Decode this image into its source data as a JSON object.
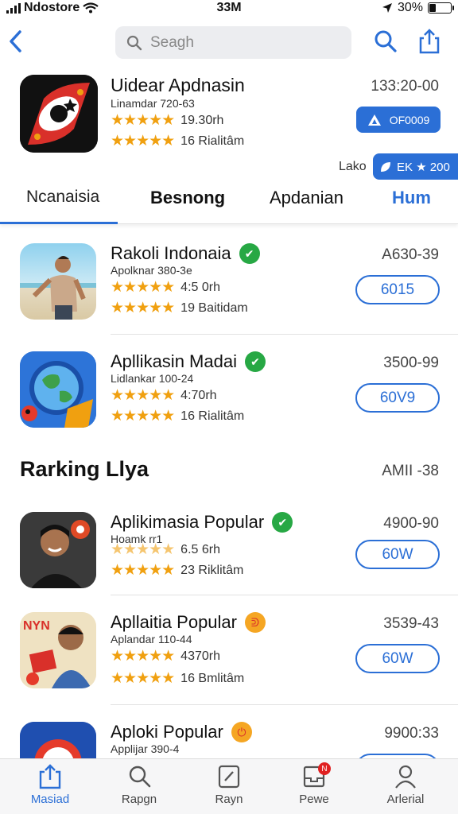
{
  "status_bar": {
    "carrier": "Ndostore",
    "time": "33M",
    "battery": "30%",
    "battery_level": 0.3
  },
  "nav": {
    "search_placeholder": "Seagh"
  },
  "featured": {
    "title": "Uidear Apdnasin",
    "subtitle": "Linamdar 720-63",
    "rating_text": "19.30rh",
    "reviews_text": "16  Rialitâm",
    "date": "133:20-00",
    "get_label": "OF0009",
    "lako_label": "Lako",
    "badge_label": "EK ★ 200"
  },
  "tabs": [
    {
      "label": "Ncanaisia",
      "active": false
    },
    {
      "label": "Besnong",
      "active": false
    },
    {
      "label": "Apdanian",
      "active": false
    },
    {
      "label": "Hum",
      "active": true
    }
  ],
  "apps": [
    {
      "title": "Rakoli Indonaia",
      "subtitle": "Apolknar 380-3e",
      "rating_text": "4:5 0rh",
      "reviews_text": "19  Baitidam",
      "date": "A630-39",
      "get_label": "6015",
      "badge_color": "#27a844"
    },
    {
      "title": "Apllikasin Madai",
      "subtitle": "Lidlankar 100-24",
      "rating_text": "4:70rh",
      "reviews_text": "16  Rialitâm",
      "date": "3500-99",
      "get_label": "60V9",
      "badge_color": "#27a844"
    }
  ],
  "section": {
    "title": "Rarking Llya",
    "meta": "AMII -38"
  },
  "ranking": [
    {
      "title": "Aplikimasia Popular",
      "subtitle": "Hoamk rr1",
      "rating_text": "6.5 6rh",
      "reviews_text": "23  Riklitâm",
      "date": "4900-90",
      "get_label": "60W",
      "badge_color": "#27a844"
    },
    {
      "title": "Apllaitia Popular",
      "subtitle": "Aplandar 110-44",
      "rating_text": "4370rh",
      "reviews_text": "16  Bmlitâm",
      "date": "3539-43",
      "get_label": "60W",
      "badge_color": "#f5a623"
    },
    {
      "title": "Aploki Popular",
      "subtitle": "Applijar 390-4",
      "rating_text": "",
      "reviews_text": "",
      "date": "9900:33",
      "get_label": "",
      "badge_color": "#f5a623"
    }
  ],
  "tabbar": [
    {
      "label": "Masiad",
      "icon": "share-icon",
      "active": true
    },
    {
      "label": "Rapgn",
      "icon": "search-icon",
      "active": false
    },
    {
      "label": "Rayn",
      "icon": "edit-icon",
      "active": false
    },
    {
      "label": "Pewe",
      "icon": "inbox-icon",
      "active": false,
      "badge": "N"
    },
    {
      "label": "Arlerial",
      "icon": "person-icon",
      "active": false
    }
  ],
  "colors": {
    "accent": "#2b6fd6",
    "star": "#f0a010",
    "verified_green": "#27a844",
    "orange_badge": "#f5a623"
  }
}
